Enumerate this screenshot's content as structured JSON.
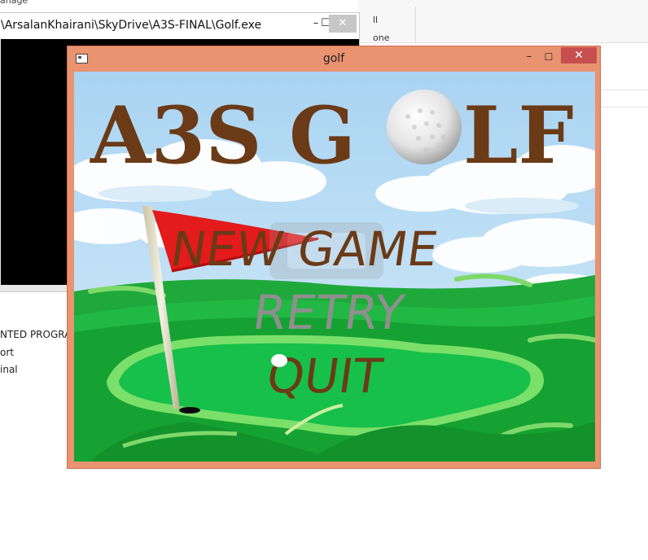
{
  "explorer": {
    "manage_fragment": "anage",
    "ribbon_text_1": "ll",
    "ribbon_text_2": "one"
  },
  "console_window": {
    "title": "\\ArsalanKhairani\\SkyDrive\\A3S-FINAL\\Golf.exe",
    "minimize_glyph": "–",
    "maximize_glyph": "☐",
    "close_glyph": "✕"
  },
  "background_list": {
    "items": [
      "NTED PROGRAM",
      "ort",
      "inal"
    ]
  },
  "golf_window": {
    "title": "golf",
    "minimize_glyph": "–",
    "maximize_glyph": "☐",
    "close_glyph": "✕"
  },
  "game": {
    "logo_text_left": "A3S G",
    "logo_text_right": "LF",
    "menu": {
      "new_game": "NEW GAME",
      "retry": "RETRY",
      "quit": "QUIT"
    },
    "colors": {
      "logo": "#6b3a16",
      "new_game": "#6b3a16",
      "retry": "#8f8f8f",
      "quit": "#6b3a16",
      "flag": "#e31b1b",
      "grass_light": "#22c24a",
      "grass_dark": "#129a2c",
      "sky": "#bfe0f7"
    }
  }
}
